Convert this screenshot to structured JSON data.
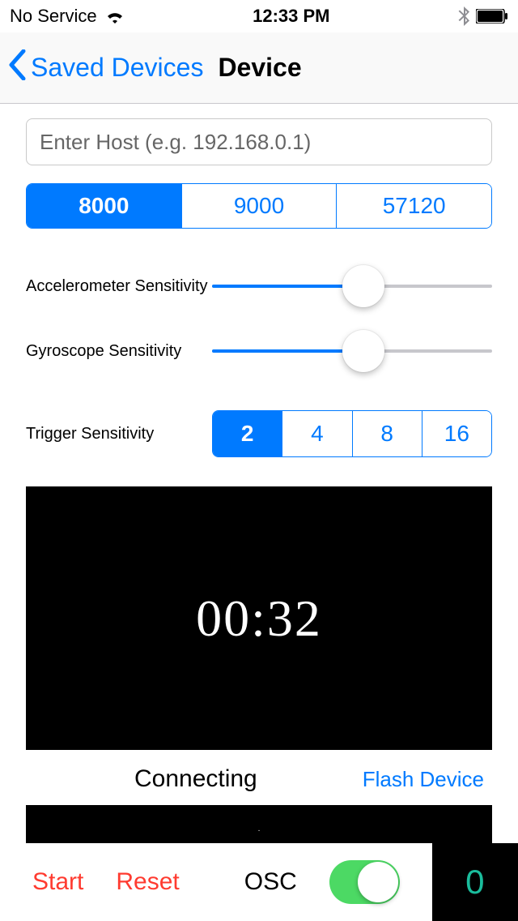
{
  "status": {
    "carrier": "No Service",
    "time": "12:33 PM"
  },
  "nav": {
    "back_label": "Saved Devices",
    "title": "Device"
  },
  "host": {
    "placeholder": "Enter Host (e.g. 192.168.0.1)",
    "value": ""
  },
  "port": {
    "options": [
      "8000",
      "9000",
      "57120"
    ],
    "selected_index": 0
  },
  "sliders": {
    "accel": {
      "label": "Accelerometer Sensitivity",
      "value_pct": 54
    },
    "gyro": {
      "label": "Gyroscope Sensitivity",
      "value_pct": 54
    }
  },
  "trigger": {
    "label": "Trigger Sensitivity",
    "options": [
      "2",
      "4",
      "8",
      "16"
    ],
    "selected_index": 0
  },
  "timer": "00:32",
  "connection": {
    "status": "Connecting",
    "flash_label": "Flash Device"
  },
  "footer": {
    "start": "Start",
    "reset": "Reset",
    "osc_label": "OSC",
    "osc_on": true,
    "count": "0"
  }
}
